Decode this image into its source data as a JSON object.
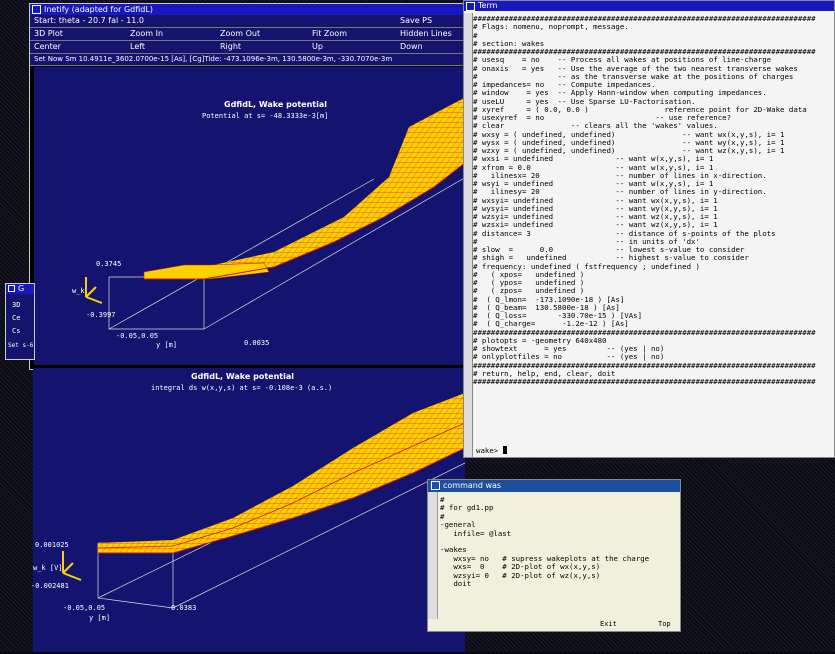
{
  "desktop": {
    "background_color": "#0b0b14"
  },
  "win_top": {
    "title": "Inetify (adapted for GdfidL)",
    "menu_row1": [
      "Start: theta - 20.7 fal - 11.0",
      "",
      "",
      "Save PS"
    ],
    "menu_row2": [
      "3D Plot",
      "Zoom In",
      "Zoom Out",
      "Fit Zoom",
      "Hidden Lines"
    ],
    "menu_row3": [
      "Center",
      "Left",
      "Right",
      "Up",
      "Down"
    ],
    "status": "Set Now Sm 10.4911e_3602.0700e-15 [As], [Cg]Tide: -473.1096e-3m, 130.5800e-3m, -330.7070e-3m",
    "plot_title": "GdfidL, Wake potential",
    "plot_subtitle": "Potential at s= -48.3333e-3[m]",
    "ztick_top": "0.3745",
    "ztick_bot": "-0.3997",
    "zlabel": "w_k",
    "ylabel": "y [m]",
    "ytick": "-0.05,0.05",
    "xtick": "0.0035"
  },
  "win_left_small": {
    "title": "G",
    "items": [
      "3D",
      "Ce",
      "Cs"
    ],
    "status": "Set s-6"
  },
  "win_bottom": {
    "plot_title": "GdfidL, Wake potential",
    "plot_subtitle": "integral ds w(x,y,s) at s= -0.108e-3 (a.s.)",
    "ztick_top": "0.001025",
    "ztick_bot": "-0.002481",
    "zlabel": "w_k [V]",
    "ylabel": "y [m]",
    "ytick": "-0.05,0.05",
    "xtick": "0.0383"
  },
  "win_term": {
    "title": "Term",
    "prompt": "wake>",
    "lines": [
      "#############################################################################",
      "# Flags: nomenu, noprompt, message.",
      "#",
      "# section: wakes",
      "#############################################################################",
      "# usesq    = no    -- Process all wakes at positions of line-charge",
      "# onaxis   = yes   -- Use the average of the two nearest transverse wakes",
      "#                  -- as the transverse wake at the positions of charges",
      "# impedances= no   -- Compute impedances.",
      "# window    = yes  -- Apply Hann-window when computing impedances.",
      "# useLU     = yes  -- Use Sparse LU-Factorisation.",
      "# xyref     = ( 0.0, 0.0 )                 reference point for 2D-Wake data",
      "# usexyref  = no                         -- use reference?",
      "# clear               -- clears all the 'wakes' values.",
      "# wxsy = ( undefined, undefined)               -- want wx(x,y,s), i= 1",
      "# wysx = ( undefined, undefined)               -- want wy(x,y,s), i= 1",
      "# wzxy = ( undefined, undefined)               -- want wz(x,y,s), i= 1",
      "# wxsi = undefined              -- want w(x,y,s), i= 1",
      "# xfrom = 0.0                   -- want w(x,y,s), i= 1",
      "#   ilinesx= 20                 -- number of lines in x-direction.",
      "# wsyi = undefined              -- want w(x,y,s), i= 1",
      "#   ilinesy= 20                 -- number of lines in y-direction.",
      "# wxsyi= undefined              -- want wx(x,y,s), i= 1",
      "# wysyi= undefined              -- want wy(x,y,s), i= 1",
      "# wzsyi= undefined              -- want wz(x,y,s), i= 1",
      "# wzsxi= undefined              -- want wz(x,y,s), i= 1",
      "# distance= 3                   -- distance of s-points of the plots",
      "#                               -- in units of 'dx'",
      "# slow  =      0.0              -- lowest s-value to consider",
      "# shigh =   undefined           -- highest s-value to consider",
      "# frequency: undefined ( fstfrequency ; undefined )",
      "#   ( xpos=   undefined )",
      "#   ( ypos=   undefined )",
      "#   ( zpos=   undefined )",
      "#  ( Q_lmon=  -173.1090e-18 ) [As]",
      "#  ( Q_beam=  130.5800e-18 ) [As]",
      "#  ( Q_loss=       -330.70e-15 ) [VAs]",
      "#  ( Q_charge=      -1.2e-12 ) [As]",
      "#############################################################################",
      "# plotopts = -geometry 640x480",
      "# showtext      = yes         -- (yes | no)",
      "# onlyplotfiles = no          -- (yes | no)",
      "#############################################################################",
      "# return, help, end, clear, doit",
      "#############################################################################"
    ]
  },
  "win_cmd": {
    "title": "command was",
    "lines": [
      "#",
      "# for gd1.pp",
      "#",
      "-general",
      "   infile= @last",
      "",
      "-wakes",
      "   wxsy= no   # supress wakeplots at the charge",
      "   wxs=  0    # 2D-plot of wx(x,y,s)",
      "   wzsyi= 0   # 2D-plot of wz(x,y,s)",
      "   doit"
    ],
    "footer_left": "Exit",
    "footer_right": "Top"
  },
  "colors": {
    "plot_bg": "#141470",
    "surface": "#ffd000",
    "mesh": "#c81818",
    "titlebar": "#1818c0"
  }
}
